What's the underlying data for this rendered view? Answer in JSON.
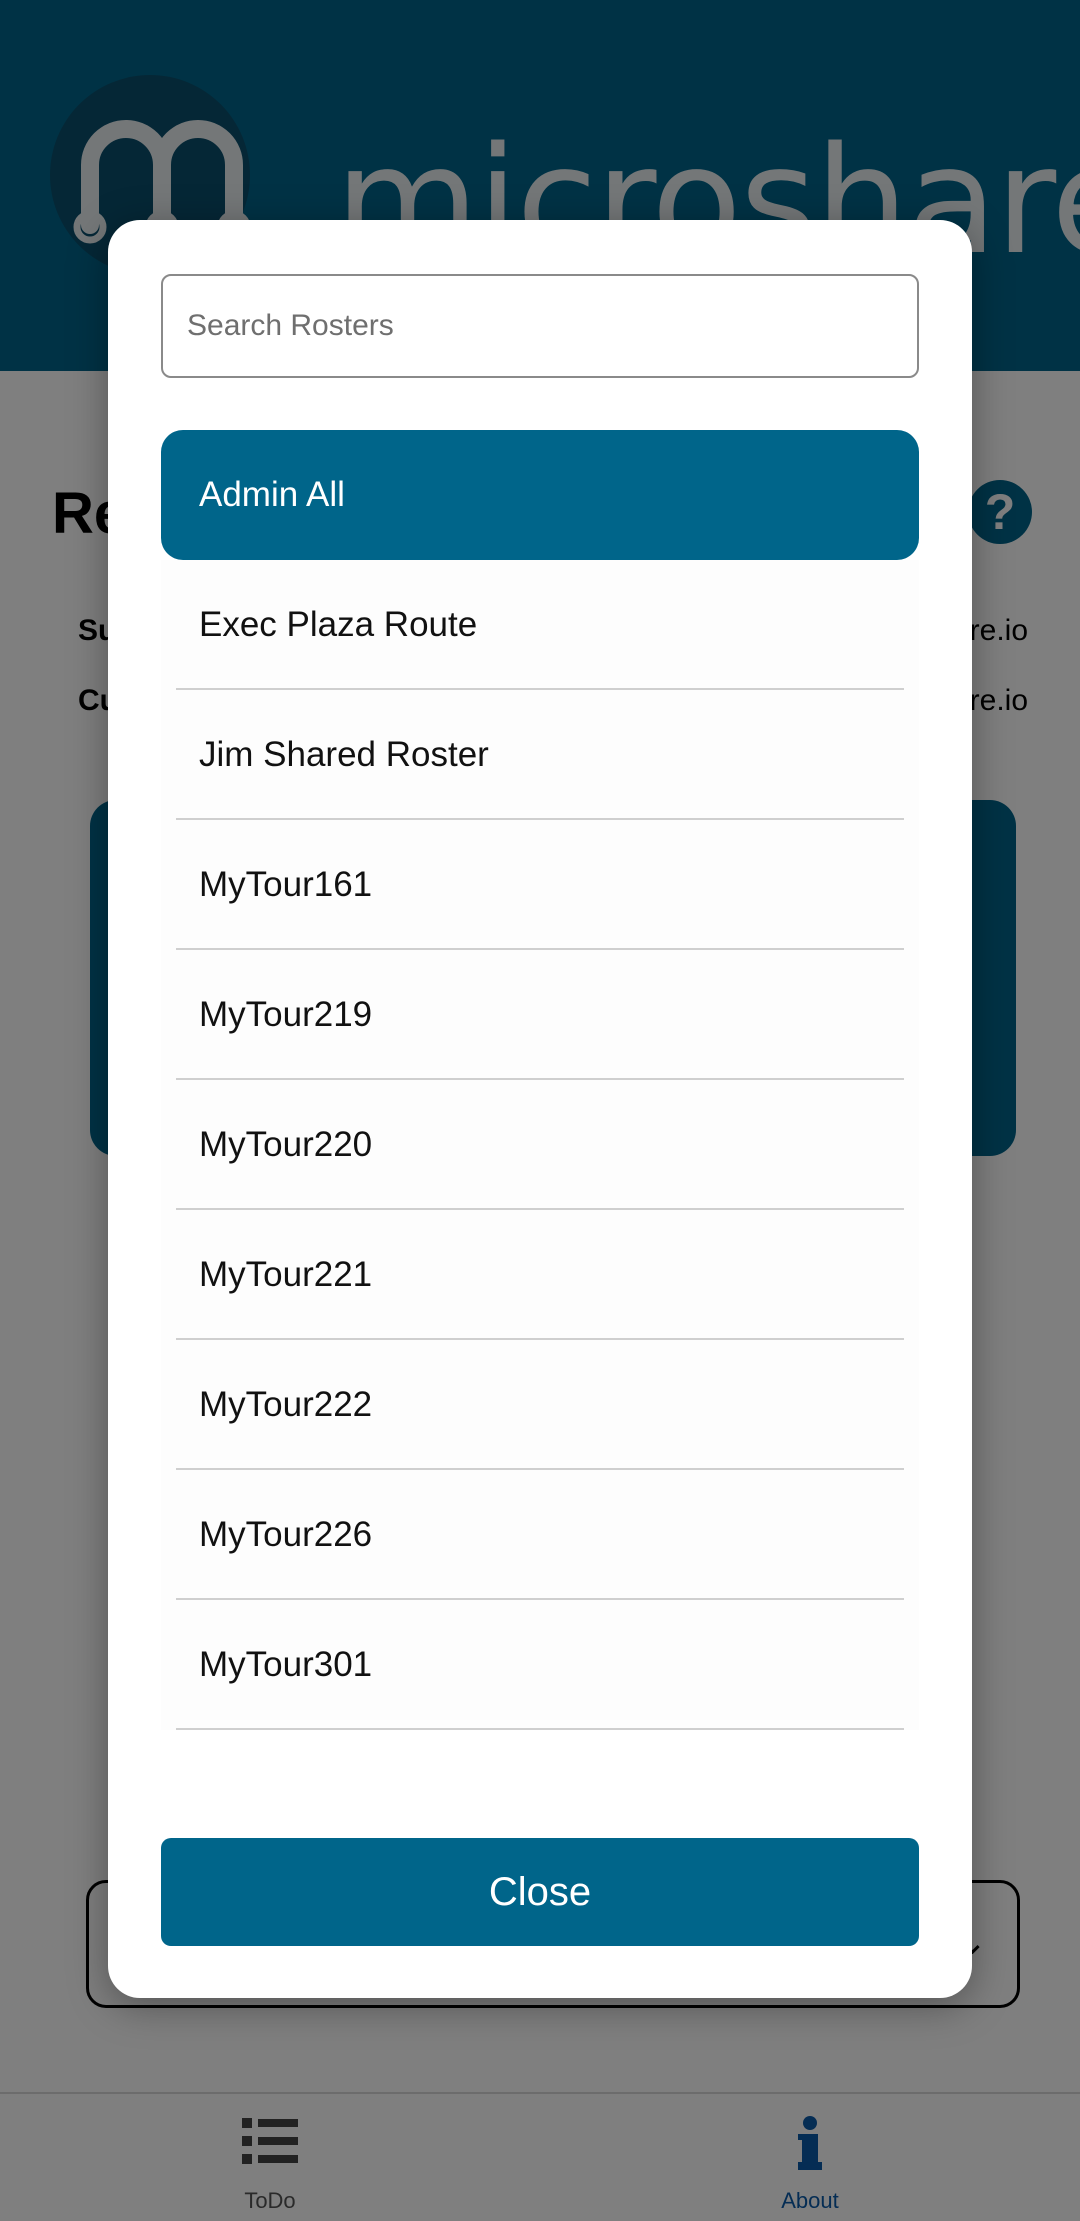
{
  "app": {
    "brand": "microshare",
    "brand_mark": "®",
    "page_title": "Re",
    "info_label_1": "Su",
    "info_value_1": "re.io",
    "info_label_2": "Cu",
    "info_value_2": "re.io",
    "select_chevron": "⌄",
    "colors": {
      "primary": "#00658a",
      "nav_active": "#0a5aa8"
    }
  },
  "modal": {
    "search": {
      "placeholder": "Search Rosters",
      "value": ""
    },
    "rosters": [
      {
        "label": "Admin All",
        "selected": true
      },
      {
        "label": "Exec Plaza Route",
        "selected": false
      },
      {
        "label": "Jim Shared Roster",
        "selected": false
      },
      {
        "label": "MyTour161",
        "selected": false
      },
      {
        "label": "MyTour219",
        "selected": false
      },
      {
        "label": "MyTour220",
        "selected": false
      },
      {
        "label": "MyTour221",
        "selected": false
      },
      {
        "label": "MyTour222",
        "selected": false
      },
      {
        "label": "MyTour226",
        "selected": false
      },
      {
        "label": "MyTour301",
        "selected": false
      }
    ],
    "close_label": "Close"
  },
  "bottom_nav": {
    "items": [
      {
        "label": "ToDo",
        "icon": "list-icon",
        "active": false
      },
      {
        "label": "About",
        "icon": "info-icon",
        "active": true
      }
    ]
  }
}
